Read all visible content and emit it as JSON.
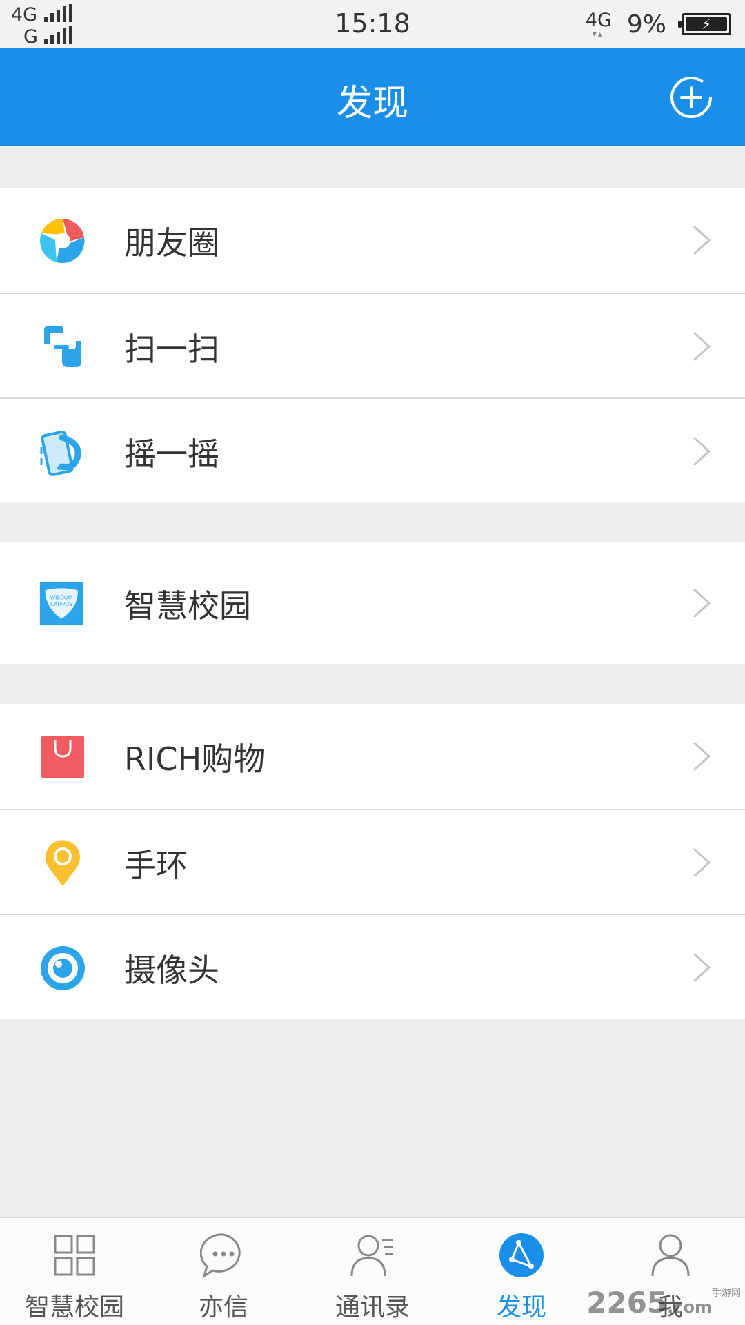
{
  "status_bar": {
    "network_top": "4G",
    "network_bottom": "G",
    "time": "15:18",
    "network_right": "4G",
    "battery_percent": "9%"
  },
  "header": {
    "title": "发现",
    "add_icon": "plus-circle-icon"
  },
  "groups": [
    {
      "items": [
        {
          "label": "朋友圈",
          "icon": "moments-icon"
        },
        {
          "label": "扫一扫",
          "icon": "scan-icon"
        },
        {
          "label": "摇一摇",
          "icon": "shake-icon"
        }
      ]
    },
    {
      "items": [
        {
          "label": "智慧校园",
          "icon": "wisdom-campus-icon",
          "icon_text_1": "WISDOM",
          "icon_text_2": "CAMPUS"
        }
      ]
    },
    {
      "items": [
        {
          "label": "RICH购物",
          "icon": "shopping-bag-icon"
        },
        {
          "label": "手环",
          "icon": "location-pin-icon"
        },
        {
          "label": "摄像头",
          "icon": "camera-eye-icon"
        }
      ]
    }
  ],
  "tab_bar": {
    "active": "发现",
    "tabs": [
      {
        "label": "智慧校园",
        "icon": "grid-icon"
      },
      {
        "label": "亦信",
        "icon": "chat-bubble-icon"
      },
      {
        "label": "通讯录",
        "icon": "contacts-icon"
      },
      {
        "label": "发现",
        "icon": "discover-icon"
      },
      {
        "label": "我",
        "icon": "person-icon"
      }
    ]
  },
  "watermark": {
    "text": "2265",
    "suffix": ".com",
    "site": "手游网"
  },
  "colors": {
    "accent": "#1a8fea",
    "background": "#ececec"
  }
}
